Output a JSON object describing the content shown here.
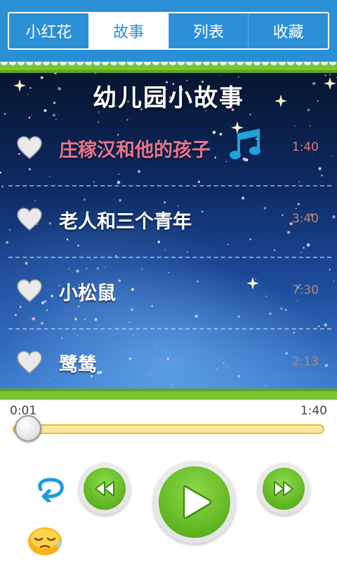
{
  "tabs": [
    {
      "label": "小红花",
      "active": false
    },
    {
      "label": "故事",
      "active": true
    },
    {
      "label": "列表",
      "active": false
    },
    {
      "label": "收藏",
      "active": false
    }
  ],
  "panel": {
    "title": "幼儿园小故事",
    "songs": [
      {
        "name": "庄稼汉和他的孩子",
        "duration": "1:40",
        "playing": true
      },
      {
        "name": "老人和三个青年",
        "duration": "3:40",
        "playing": false
      },
      {
        "name": "小松鼠",
        "duration": "7:30",
        "playing": false
      },
      {
        "name": "鹭鸶",
        "duration": "2:13",
        "playing": false
      }
    ]
  },
  "player": {
    "current_time": "0:01",
    "total_time": "1:40",
    "progress_fraction": 0.01
  },
  "icons": {
    "favorite": "heart-icon",
    "now_playing": "music-note-icon",
    "repeat": "repeat-icon",
    "rewind": "rewind-icon",
    "play": "play-icon",
    "forward": "fast-forward-icon",
    "sleep": "sleepy-face-icon"
  },
  "colors": {
    "brand_blue": "#2b8fd6",
    "green": "#7ac431",
    "playing_text": "#e9748a",
    "track": "#fde79a"
  }
}
